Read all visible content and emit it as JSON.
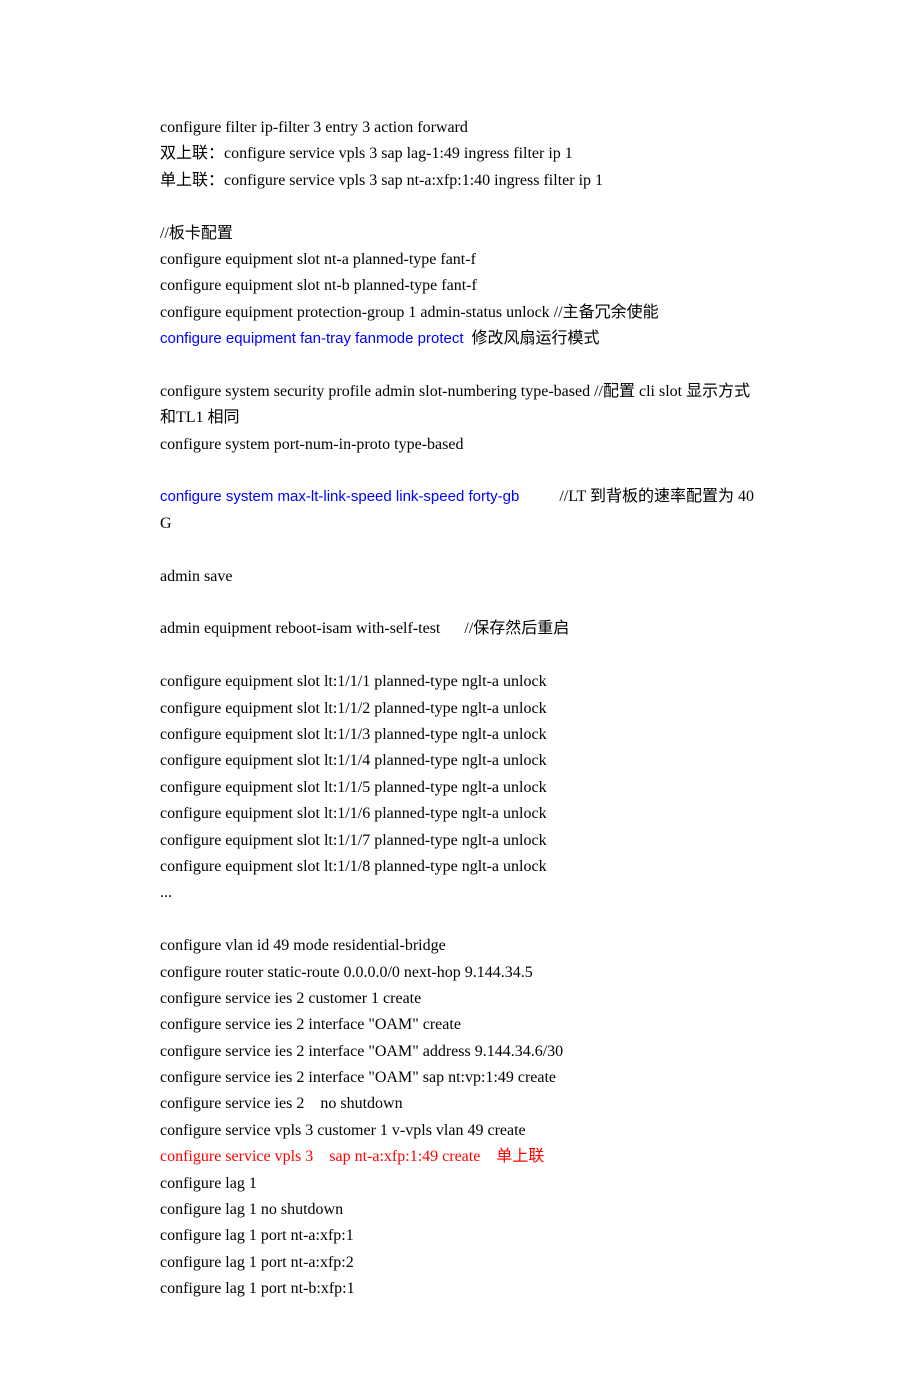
{
  "lines": {
    "l1": "configure filter ip-filter 3 entry 3 action forward",
    "l2": "双上联：configure service vpls 3 sap lag-1:49 ingress filter ip 1",
    "l3": "单上联：configure service vpls 3 sap nt-a:xfp:1:40 ingress filter ip 1",
    "l4": "//板卡配置",
    "l5": "configure equipment slot nt-a planned-type fant-f",
    "l6": "configure equipment slot nt-b planned-type fant-f",
    "l7a": "configure equipment protection-group 1 admin-status unlock ",
    "l7b": "//主备冗余使能",
    "l8a": "configure equipment fan-tray fanmode protect",
    "l8b": "  修改风扇运行模式",
    "l9a": "configure system security profile admin slot-numbering type-based ",
    "l9b": "//配置 cli slot 显示方式和TL1 相同",
    "l10": "configure system port-num-in-proto type-based",
    "l11a": "configure system max-lt-link-speed link-speed forty-gb",
    "l11b": "          //LT 到背板的速率配置为 40G",
    "l12": "admin save",
    "l13a": "admin equipment reboot-isam with-self-test      ",
    "l13b": "//保存然后重启",
    "l14": "configure equipment slot lt:1/1/1 planned-type nglt-a unlock",
    "l15": "configure equipment slot lt:1/1/2 planned-type nglt-a unlock",
    "l16": "configure equipment slot lt:1/1/3 planned-type nglt-a unlock",
    "l17": "configure equipment slot lt:1/1/4 planned-type nglt-a unlock",
    "l18": "configure equipment slot lt:1/1/5 planned-type nglt-a unlock",
    "l19": "configure equipment slot lt:1/1/6 planned-type nglt-a unlock",
    "l20": "configure equipment slot lt:1/1/7 planned-type nglt-a unlock",
    "l21": "configure equipment slot lt:1/1/8 planned-type nglt-a unlock",
    "l22": "...",
    "l23": "configure vlan id 49 mode residential-bridge",
    "l24": "configure router static-route 0.0.0.0/0 next-hop 9.144.34.5",
    "l25": "configure service ies 2 customer 1 create",
    "l26": "configure service ies 2 interface \"OAM\" create",
    "l27": "configure service ies 2 interface \"OAM\" address 9.144.34.6/30",
    "l28": "configure service ies 2 interface \"OAM\" sap nt:vp:1:49 create",
    "l29": "configure service ies 2    no shutdown",
    "l30": "configure service vpls 3 customer 1 v-vpls vlan 49 create",
    "l31a": "configure service vpls 3    sap nt-a:xfp:1:49 create    ",
    "l31b": "单上联",
    "l32": "configure lag 1",
    "l33": "configure lag 1 no shutdown",
    "l34": "configure lag 1 port nt-a:xfp:1",
    "l35": "configure lag 1 port nt-a:xfp:2",
    "l36": "configure lag 1 port nt-b:xfp:1"
  }
}
